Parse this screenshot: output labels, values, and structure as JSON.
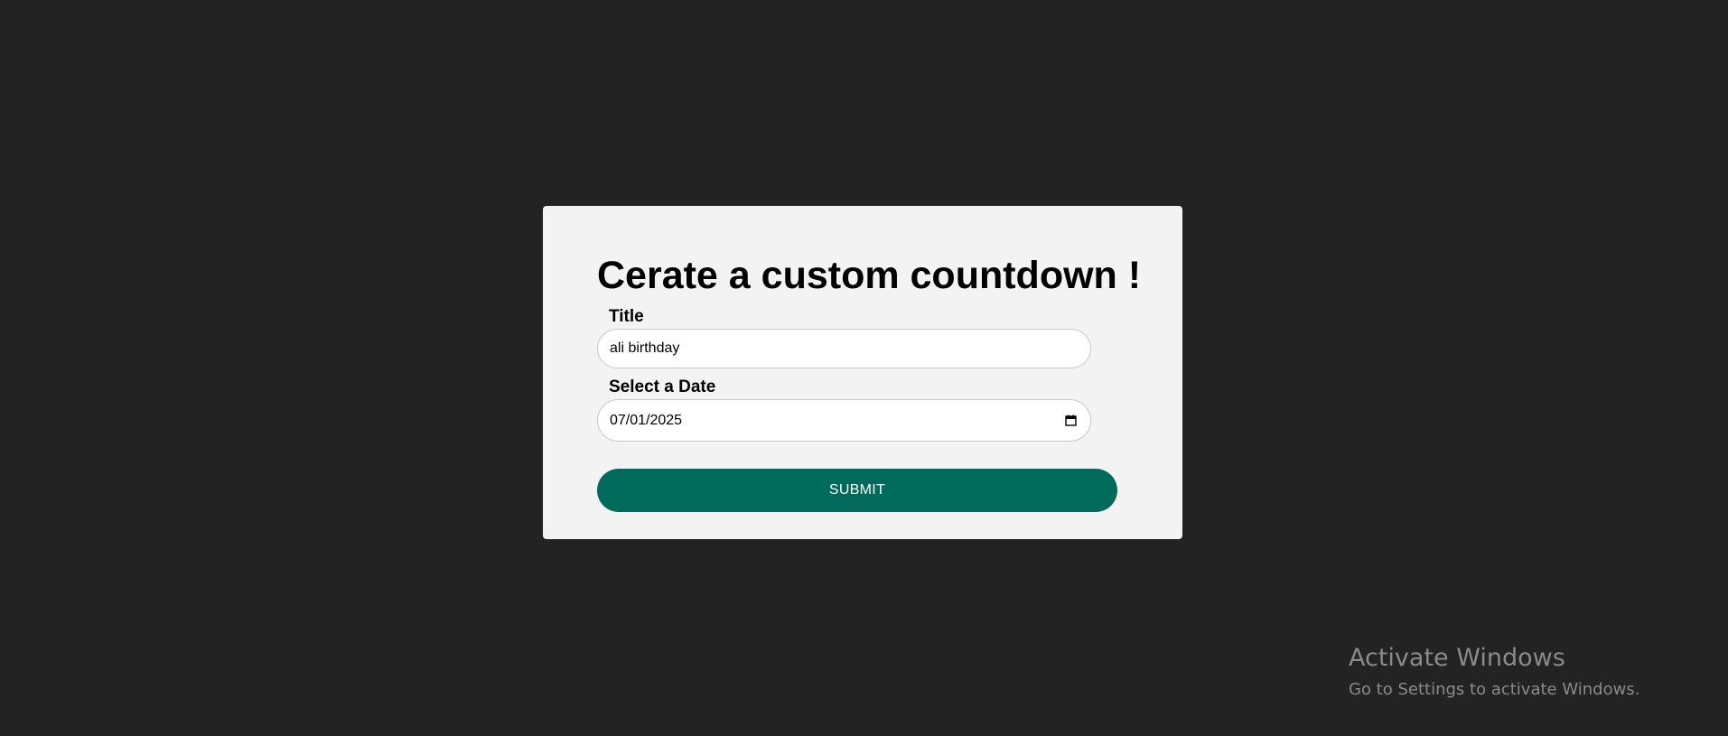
{
  "form": {
    "heading": "Cerate a custom countdown !",
    "title_label": "Title",
    "title_value": "ali birthday",
    "date_label": "Select a Date",
    "date_value": "07/01/2025",
    "submit_label": "SUBMIT"
  },
  "watermark": {
    "title": "Activate Windows",
    "subtitle": "Go to Settings to activate Windows."
  },
  "colors": {
    "background": "#232323",
    "card": "#f3f3f3",
    "accent": "#006b5a"
  },
  "icons": {
    "date_picker": "calendar-icon"
  }
}
